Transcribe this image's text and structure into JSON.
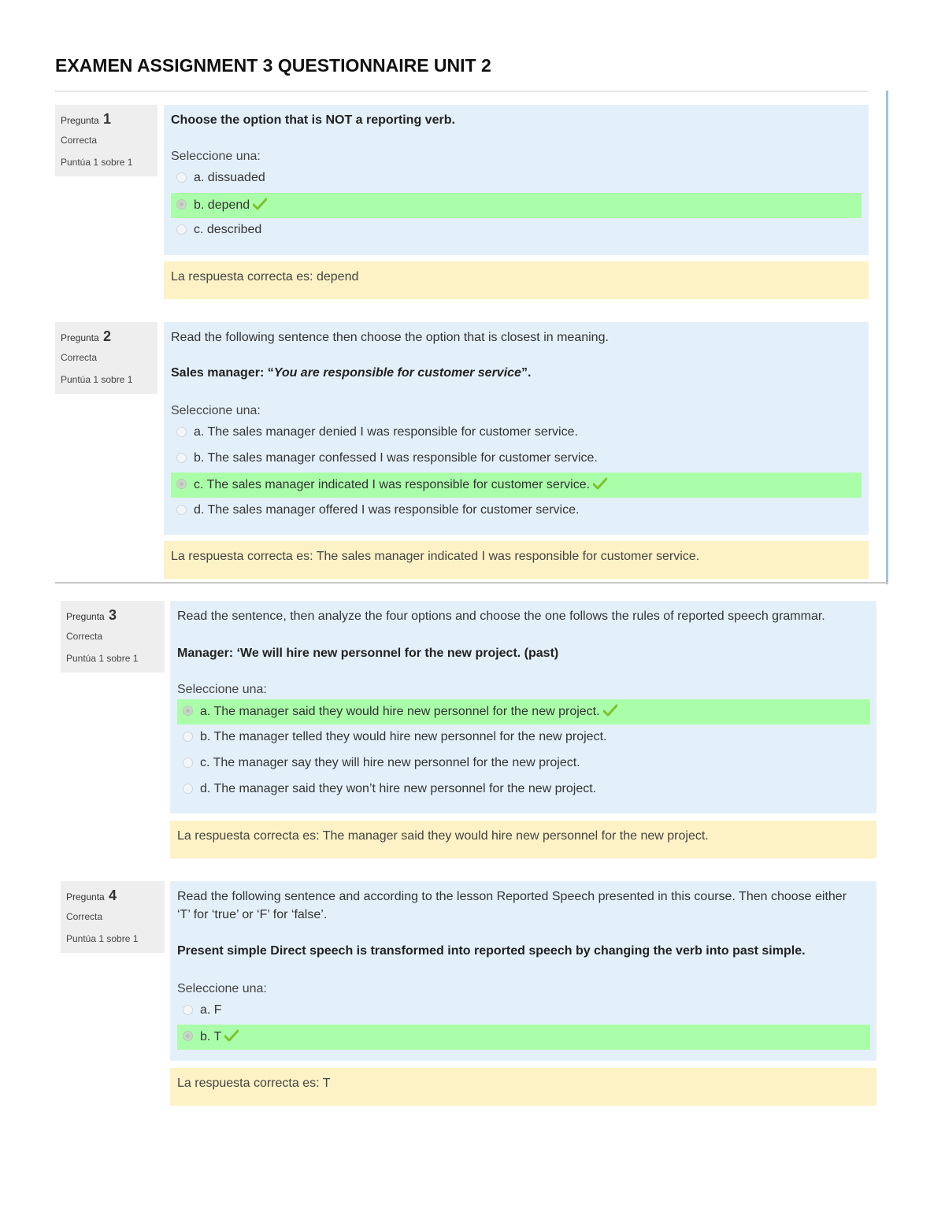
{
  "document": {
    "title": "EXAMEN ASSIGNMENT 3 QUESTIONNAIRE UNIT 2"
  },
  "labels": {
    "question_prefix": "Pregunta",
    "select_one": "Seleccione una:",
    "correct_answer_prefix": "La respuesta correcta es:"
  },
  "colors": {
    "info_bg": "#eeeeee",
    "content_bg": "#e4f0f9",
    "correct_answer_bg": "#aafea9",
    "feedback_bg": "#fcf2c5",
    "checkmark": "#7cc22e",
    "frame_accent": "#9fc3db"
  },
  "questions": [
    {
      "number": "1",
      "state": "Correcta",
      "grade": "Puntúa 1 sobre 1",
      "text": "Choose the option that is NOT a reporting verb.",
      "text_bold": true,
      "prompt": "Seleccione una:",
      "answers": [
        {
          "label": "a. dissuaded",
          "selected": false,
          "correct": false
        },
        {
          "label": "b. depend",
          "selected": true,
          "correct": true,
          "icon": "checkmark-icon"
        },
        {
          "label": "c. described",
          "selected": false,
          "correct": false
        }
      ],
      "feedback": "La respuesta correcta es: depend"
    },
    {
      "number": "2",
      "state": "Correcta",
      "grade": "Puntúa 1 sobre 1",
      "text": "Read the following sentence then choose the option that is closest in meaning.",
      "quote": {
        "speaker": "Sales manager: “",
        "italic": "You are responsible for customer service",
        "end": "”."
      },
      "prompt": "Seleccione una:",
      "answers": [
        {
          "label": "a. The sales manager denied I was responsible for customer service.",
          "selected": false,
          "correct": false
        },
        {
          "label": "b. The sales manager confessed I was responsible for customer service.",
          "selected": false,
          "correct": false
        },
        {
          "label": "c. The sales manager indicated I was responsible for customer service.",
          "selected": true,
          "correct": true,
          "icon": "checkmark-icon"
        },
        {
          "label": "d. The sales manager offered I was responsible for customer service.",
          "selected": false,
          "correct": false
        }
      ],
      "feedback": "La respuesta correcta es: The sales manager indicated I was responsible for customer service."
    },
    {
      "number": "3",
      "state": "Correcta",
      "grade": "Puntúa 1 sobre 1",
      "text": "Read the sentence, then analyze the four options and choose the one follows the rules of reported speech grammar.",
      "statement": "Manager: ‘We will hire new personnel for the new project. (past)",
      "prompt": "Seleccione una:",
      "answers": [
        {
          "label": "a. The manager said they would hire new personnel for the new project.",
          "selected": true,
          "correct": true,
          "icon": "checkmark-icon"
        },
        {
          "label": "b. The manager telled they would hire new personnel for the new project.",
          "selected": false,
          "correct": false
        },
        {
          "label": "c. The manager say they will hire new personnel for the new project.",
          "selected": false,
          "correct": false
        },
        {
          "label": "d. The manager said they won’t hire new personnel for the new project.",
          "selected": false,
          "correct": false
        }
      ],
      "feedback": "La respuesta correcta es: The manager said they would hire new personnel for the new project."
    },
    {
      "number": "4",
      "state": "Correcta",
      "grade": "Puntúa 1 sobre 1",
      "text_line1": "Read the following sentence and according to the lesson Reported Speech presented in this course. Then choose either",
      "text_line2": "‘T’ for ‘true’ or ‘F’ for ‘false’.",
      "statement": "Present simple Direct speech is transformed into reported speech by changing the verb into past simple.",
      "prompt": "Seleccione una:",
      "answers": [
        {
          "label": "a. F",
          "selected": false,
          "correct": false
        },
        {
          "label": "b. T",
          "selected": true,
          "correct": true,
          "icon": "checkmark-icon"
        }
      ],
      "feedback": "La respuesta correcta es: T"
    }
  ]
}
